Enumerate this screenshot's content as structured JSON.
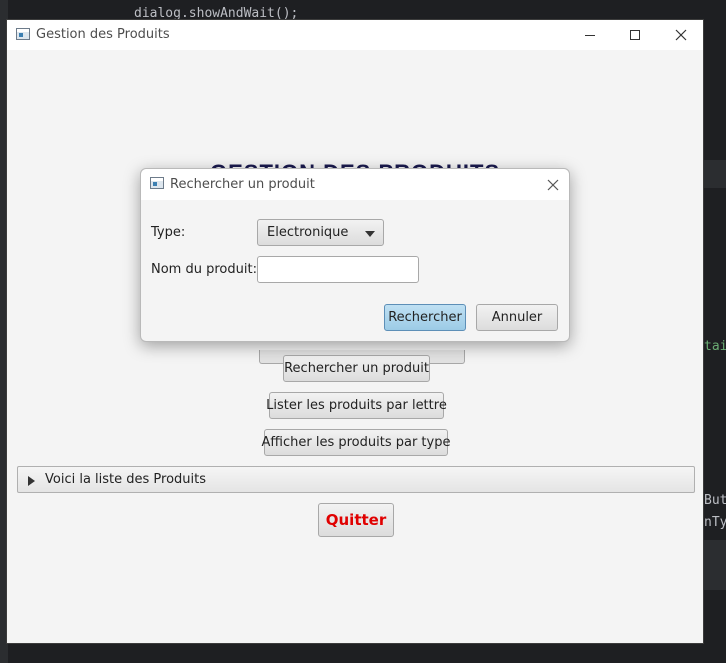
{
  "background_ide": {
    "code_line": "dialog.showAndWait();",
    "right_fragment_1": "tai",
    "right_fragment_2": "But",
    "right_fragment_3": "nTy"
  },
  "main_window": {
    "title": "Gestion des Produits",
    "heading": "GESTION DES PRODUITS",
    "buttons": {
      "search": "Rechercher un produit",
      "list_by_letter": "Lister les produits par lettre",
      "show_by_type": "Afficher les produits par type"
    },
    "titled_pane_label": "Voici la liste des Produits",
    "quit_label": "Quitter",
    "colors": {
      "quit_text": "#e00000",
      "heading": "#1a1a4e"
    }
  },
  "dialog": {
    "title": "Rechercher un produit",
    "type_label": "Type:",
    "type_value": "Electronique",
    "name_label": "Nom du produit:",
    "name_value": "",
    "search_button": "Rechercher",
    "cancel_button": "Annuler",
    "colors": {
      "primary_button": "#9ccbe6"
    }
  },
  "icons": [
    "app-icon",
    "minimize-icon",
    "maximize-icon",
    "close-icon",
    "expand-arrow-icon",
    "dropdown-arrow-icon"
  ]
}
